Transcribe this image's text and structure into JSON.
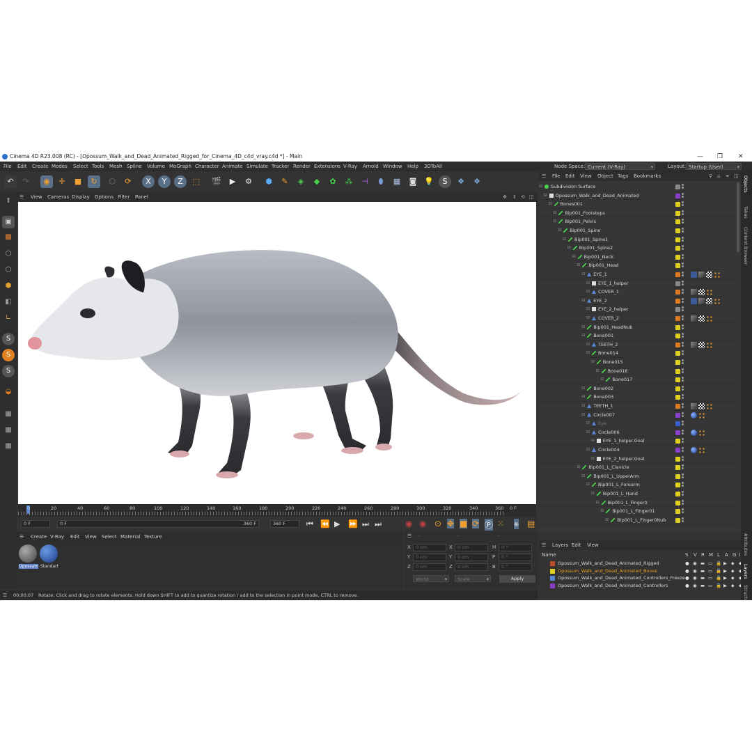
{
  "window": {
    "title": "Cinema 4D R23.008 (RC) - [Opossum_Walk_and_Dead_Animated_Rigged_for_Cinema_4D_c4d_vray.c4d *] - Main",
    "controls": [
      "—",
      "❐",
      "✕"
    ]
  },
  "menu": [
    "File",
    "Edit",
    "Create",
    "Modes",
    "Select",
    "Tools",
    "Mesh",
    "Spline",
    "Volume",
    "MoGraph",
    "Character",
    "Animate",
    "Simulate",
    "Tracker",
    "Render",
    "Extensions",
    "V-Ray",
    "Arnold",
    "Window",
    "Help",
    "3DToAll"
  ],
  "node_space": {
    "label": "Node Space:",
    "value": "Current (V-Ray)"
  },
  "layout": {
    "label": "Layout:",
    "value": "Startup (User)"
  },
  "viewport_menu": [
    "View",
    "Cameras",
    "Display",
    "Options",
    "Filter",
    "Panel"
  ],
  "toolbar_icons": [
    "undo-icon",
    "redo-icon",
    "live-select-icon",
    "move-icon",
    "scale-icon",
    "rotate-icon",
    "recent-tools-icon",
    "axis-x-icon",
    "axis-y-icon",
    "axis-z-icon",
    "coordinate-system-icon",
    "render-view-icon",
    "render-picture-viewer-icon",
    "render-settings-icon",
    "cube-icon",
    "pen-icon",
    "subdivision-icon",
    "extrude-icon",
    "cloner-icon",
    "effector-icon",
    "deformer-icon",
    "environment-icon",
    "floor-icon",
    "camera-icon",
    "light-icon",
    "vray-icon",
    "python-icon",
    "python-script-icon"
  ],
  "timeline": {
    "ticks": [
      "0",
      "20",
      "40",
      "60",
      "80",
      "100",
      "120",
      "140",
      "160",
      "180",
      "200",
      "220",
      "240",
      "260",
      "280",
      "300",
      "320",
      "340",
      "360"
    ],
    "current_frame_label": "0 F",
    "start_field": "0 F",
    "range_start": "0 F",
    "range_end": "360 F",
    "end_field": "360 F"
  },
  "material_menu": [
    "Create",
    "V-Ray",
    "Edit",
    "View",
    "Select",
    "Material",
    "Texture"
  ],
  "materials": [
    {
      "name": "Opossum",
      "selected": true
    },
    {
      "name": "Standart",
      "selected": false
    }
  ],
  "coordinates": {
    "rows": [
      {
        "a": "X",
        "av": "0 cm",
        "b": "X",
        "bv": "0 cm",
        "c": "H",
        "cv": "0 °"
      },
      {
        "a": "Y",
        "av": "0 cm",
        "b": "Y",
        "bv": "0 cm",
        "c": "P",
        "cv": "0 °"
      },
      {
        "a": "Z",
        "av": "0 cm",
        "b": "Z",
        "bv": "0 cm",
        "c": "B",
        "cv": "0 °"
      }
    ],
    "mode": "World",
    "scale_mode": "Scale",
    "apply": "Apply",
    "header_dashes": [
      "--",
      "--",
      "--"
    ]
  },
  "status": {
    "time": "00:00:07",
    "message": "Rotate: Click and drag to rotate elements. Hold down SHIFT to add to quantize rotation / add to the selection in point mode, CTRL to remove."
  },
  "object_manager": {
    "menu": [
      "File",
      "Edit",
      "View",
      "Object",
      "Tags",
      "Bookmarks"
    ],
    "rows": [
      {
        "name": "Subdivision Surface",
        "depth": 0,
        "icon": "subdivision-icon",
        "color": "#888888",
        "tags": []
      },
      {
        "name": "Opossum_Walk_and_Dead_Animated",
        "depth": 1,
        "icon": "null-icon",
        "color": "#8a3fc8",
        "tags": []
      },
      {
        "name": "Bones001",
        "depth": 2,
        "icon": "bone-icon",
        "color": "#e0d020",
        "tags": []
      },
      {
        "name": "Bip001_Footsteps",
        "depth": 3,
        "icon": "bone-icon",
        "color": "#e0d020",
        "tags": []
      },
      {
        "name": "Bip001_Pelvis",
        "depth": 3,
        "icon": "bone-icon",
        "color": "#e0d020",
        "tags": []
      },
      {
        "name": "Bip001_Spine",
        "depth": 4,
        "icon": "bone-icon",
        "color": "#e0d020",
        "tags": []
      },
      {
        "name": "Bip001_Spine1",
        "depth": 5,
        "icon": "bone-icon",
        "color": "#e0d020",
        "tags": []
      },
      {
        "name": "Bip001_Spine2",
        "depth": 6,
        "icon": "bone-icon",
        "color": "#e0d020",
        "tags": []
      },
      {
        "name": "Bip001_Neck",
        "depth": 7,
        "icon": "bone-icon",
        "color": "#e0d020",
        "tags": []
      },
      {
        "name": "Bip001_Head",
        "depth": 8,
        "icon": "bone-icon",
        "color": "#e0d020",
        "tags": []
      },
      {
        "name": "EYE_1",
        "depth": 9,
        "icon": "joint-icon",
        "color": "#e07a20",
        "tags": [
          "constraint",
          "phong",
          "checker",
          "dots"
        ]
      },
      {
        "name": "EYE_1_helper",
        "depth": 10,
        "icon": "null-icon",
        "color": "#888888",
        "tags": []
      },
      {
        "name": "COVER_1",
        "depth": 10,
        "icon": "joint-icon",
        "color": "#e07a20",
        "tags": [
          "phong",
          "checker",
          "dots"
        ]
      },
      {
        "name": "EYE_2",
        "depth": 9,
        "icon": "joint-icon",
        "color": "#e07a20",
        "tags": [
          "constraint",
          "phong",
          "checker",
          "dots"
        ]
      },
      {
        "name": "EYE_2_helper",
        "depth": 10,
        "icon": "null-icon",
        "color": "#888888",
        "tags": []
      },
      {
        "name": "COVER_2",
        "depth": 10,
        "icon": "joint-icon",
        "color": "#e07a20",
        "tags": [
          "phong",
          "checker",
          "dots"
        ]
      },
      {
        "name": "Bip001_HeadNub",
        "depth": 9,
        "icon": "bone-icon",
        "color": "#e0d020",
        "tags": []
      },
      {
        "name": "Bone001",
        "depth": 9,
        "icon": "bone-icon",
        "color": "#e0d020",
        "tags": []
      },
      {
        "name": "TEETH_2",
        "depth": 10,
        "icon": "joint-icon",
        "color": "#e07a20",
        "tags": [
          "phong",
          "checker",
          "dots"
        ]
      },
      {
        "name": "Bone014",
        "depth": 10,
        "icon": "bone-icon",
        "color": "#e0d020",
        "tags": []
      },
      {
        "name": "Bone015",
        "depth": 11,
        "icon": "bone-icon",
        "color": "#e0d020",
        "tags": []
      },
      {
        "name": "Bone016",
        "depth": 12,
        "icon": "bone-icon",
        "color": "#e0d020",
        "tags": []
      },
      {
        "name": "Bone017",
        "depth": 13,
        "icon": "bone-icon",
        "color": "#e0d020",
        "tags": []
      },
      {
        "name": "Bone002",
        "depth": 9,
        "icon": "bone-icon",
        "color": "#e0d020",
        "tags": []
      },
      {
        "name": "Bone003",
        "depth": 9,
        "icon": "bone-icon",
        "color": "#e0d020",
        "tags": []
      },
      {
        "name": "TEETH_1",
        "depth": 9,
        "icon": "joint-icon",
        "color": "#e07a20",
        "tags": [
          "phong",
          "checker",
          "dots"
        ]
      },
      {
        "name": "Circle007",
        "depth": 9,
        "icon": "spline-icon",
        "color": "#8a3fc8",
        "tags": [
          "sphere",
          "dots"
        ]
      },
      {
        "name": "Eye",
        "depth": 10,
        "icon": "joint-icon",
        "color": "#3a5fd0",
        "tags": [],
        "dim": true
      },
      {
        "name": "Circle006",
        "depth": 10,
        "icon": "spline-icon",
        "color": "#8a3fc8",
        "tags": [
          "sphere",
          "dots"
        ]
      },
      {
        "name": "EYE_1_helper.Goal",
        "depth": 11,
        "icon": "null-icon",
        "color": "#e0d020",
        "tags": []
      },
      {
        "name": "Circle004",
        "depth": 10,
        "icon": "spline-icon",
        "color": "#8a3fc8",
        "tags": [
          "sphere",
          "dots"
        ]
      },
      {
        "name": "EYE_2_helper.Goal",
        "depth": 11,
        "icon": "null-icon",
        "color": "#e0d020",
        "tags": []
      },
      {
        "name": "Bip001_L_Clavicle",
        "depth": 8,
        "icon": "bone-icon",
        "color": "#e0d020",
        "tags": []
      },
      {
        "name": "Bip001_L_UpperArm",
        "depth": 9,
        "icon": "bone-icon",
        "color": "#e0d020",
        "tags": []
      },
      {
        "name": "Bip001_L_Forearm",
        "depth": 10,
        "icon": "bone-icon",
        "color": "#e0d020",
        "tags": []
      },
      {
        "name": "Bip001_L_Hand",
        "depth": 11,
        "icon": "bone-icon",
        "color": "#e0d020",
        "tags": []
      },
      {
        "name": "Bip001_L_Finger0",
        "depth": 12,
        "icon": "bone-icon",
        "color": "#e0d020",
        "tags": []
      },
      {
        "name": "Bip001_L_Finger01",
        "depth": 13,
        "icon": "bone-icon",
        "color": "#e0d020",
        "tags": []
      },
      {
        "name": "Bip001_L_Finger0Nub",
        "depth": 14,
        "icon": "bone-icon",
        "color": "#e0d020",
        "tags": []
      }
    ]
  },
  "layer_manager": {
    "menu": [
      "Layers",
      "Edit",
      "View"
    ],
    "header": {
      "name": "Name",
      "cols": [
        "S",
        "V",
        "R",
        "M",
        "L",
        "A",
        "G",
        "I"
      ]
    },
    "rows": [
      {
        "name": "Opossum_Walk_and_Dead_Animated_Rigged",
        "color": "#c0502a",
        "text_color": "#d6d6d6"
      },
      {
        "name": "Opossum_Walk_and_Dead_Animated_Bones",
        "color": "#e0d020",
        "text_color": "#e0a020"
      },
      {
        "name": "Opossum_Walk_and_Dead_Animated_Controllers_Freeze",
        "color": "#5a8ad8",
        "text_color": "#d6d6d6"
      },
      {
        "name": "Opossum_Walk_and_Dead_Animated_Controllers",
        "color": "#8a3fc8",
        "text_color": "#d6d6d6"
      }
    ]
  },
  "side_tabs": [
    "Objects",
    "Takes",
    "Content Browser",
    "Attributes",
    "Layers",
    "Structure"
  ]
}
